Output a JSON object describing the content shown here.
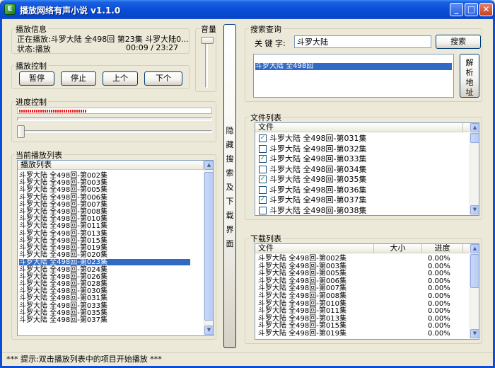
{
  "window": {
    "title": "播放网络有声小说 v1.1.0",
    "minimize": "_",
    "maximize": "□",
    "close": "✕",
    "icon_glyph": "E"
  },
  "playback_info": {
    "label": "播放信息",
    "now_playing": "正在播放:斗罗大陆 全498回 第23集 斗罗大陆0...",
    "status": "状态:播放",
    "time": "00:09  /  23:27"
  },
  "volume": {
    "label": "音量"
  },
  "playback_control": {
    "label": "播放控制",
    "pause": "暂停",
    "stop": "停止",
    "prev": "上个",
    "next": "下个"
  },
  "progress": {
    "label": "进度控制",
    "fraction": 0.35
  },
  "playlist": {
    "label": "当前播放列表",
    "header": "播放列表",
    "items": [
      "斗罗大陆 全498回-第002集",
      "斗罗大陆 全498回-第003集",
      "斗罗大陆 全498回-第005集",
      "斗罗大陆 全498回-第006集",
      "斗罗大陆 全498回-第007集",
      "斗罗大陆 全498回-第008集",
      "斗罗大陆 全498回-第010集",
      "斗罗大陆 全498回-第011集",
      "斗罗大陆 全498回-第013集",
      "斗罗大陆 全498回-第015集",
      "斗罗大陆 全498回-第019集",
      "斗罗大陆 全498回-第020集",
      "斗罗大陆 全498回-第023集",
      "斗罗大陆 全498回-第024集",
      "斗罗大陆 全498回-第026集",
      "斗罗大陆 全498回-第028集",
      "斗罗大陆 全498回-第030集",
      "斗罗大陆 全498回-第031集",
      "斗罗大陆 全498回-第033集",
      "斗罗大陆 全498回-第035集",
      "斗罗大陆 全498回-第037集"
    ],
    "selected_index": 12
  },
  "toggle_panel": {
    "label": "隐藏搜索及下载界面"
  },
  "search": {
    "label": "搜索查询",
    "keyword_label": "关 键 字:",
    "keyword_value": "斗罗大陆",
    "search_button": "搜索",
    "parse_button": "解析地址",
    "results": [
      "斗罗大陆 全498回"
    ]
  },
  "file_list": {
    "label": "文件列表",
    "header": "文件",
    "items": [
      {
        "name": "斗罗大陆 全498回-第031集",
        "checked": true
      },
      {
        "name": "斗罗大陆 全498回-第032集",
        "checked": false
      },
      {
        "name": "斗罗大陆 全498回-第033集",
        "checked": true
      },
      {
        "name": "斗罗大陆 全498回-第034集",
        "checked": false
      },
      {
        "name": "斗罗大陆 全498回-第035集",
        "checked": true
      },
      {
        "name": "斗罗大陆 全498回-第036集",
        "checked": false
      },
      {
        "name": "斗罗大陆 全498回-第037集",
        "checked": true
      },
      {
        "name": "斗罗大陆 全498回-第038集",
        "checked": false
      }
    ]
  },
  "download_list": {
    "label": "下载列表",
    "col_file": "文件",
    "col_size": "大小",
    "col_progress": "进度",
    "items": [
      {
        "name": "斗罗大陆 全498回-第002集",
        "progress": "0.00%"
      },
      {
        "name": "斗罗大陆 全498回-第003集",
        "progress": "0.00%"
      },
      {
        "name": "斗罗大陆 全498回-第005集",
        "progress": "0.00%"
      },
      {
        "name": "斗罗大陆 全498回-第006集",
        "progress": "0.00%"
      },
      {
        "name": "斗罗大陆 全498回-第007集",
        "progress": "0.00%"
      },
      {
        "name": "斗罗大陆 全498回-第008集",
        "progress": "0.00%"
      },
      {
        "name": "斗罗大陆 全498回-第010集",
        "progress": "0.00%"
      },
      {
        "name": "斗罗大陆 全498回-第011集",
        "progress": "0.00%"
      },
      {
        "name": "斗罗大陆 全498回-第013集",
        "progress": "0.00%"
      },
      {
        "name": "斗罗大陆 全498回-第015集",
        "progress": "0.00%"
      },
      {
        "name": "斗罗大陆 全498回-第019集",
        "progress": "0.00%"
      }
    ]
  },
  "status_bar": {
    "tip": "*** 提示:双击播放列表中的项目开始播放 ***"
  },
  "colors": {
    "title_bar": "#0A4ED8",
    "selection": "#316AC5",
    "progress_dots": "#E02020"
  }
}
